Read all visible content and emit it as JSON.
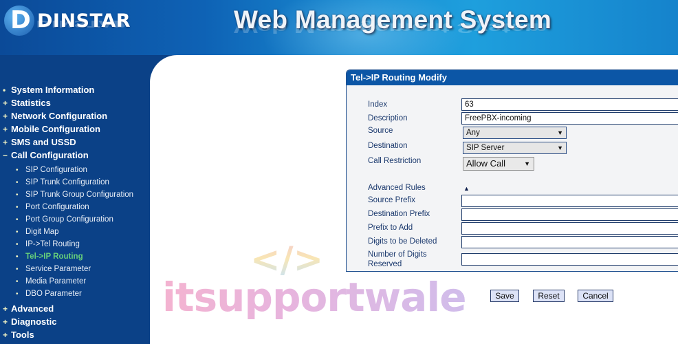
{
  "header": {
    "brand": "DINSTAR",
    "brand_mark": "D",
    "title": "Web Management System"
  },
  "sidebar": {
    "items": [
      {
        "symbol": "•",
        "label": "System Information"
      },
      {
        "symbol": "+",
        "label": "Statistics"
      },
      {
        "symbol": "+",
        "label": "Network Configuration"
      },
      {
        "symbol": "+",
        "label": "Mobile Configuration"
      },
      {
        "symbol": "+",
        "label": "SMS and USSD"
      },
      {
        "symbol": "−",
        "label": "Call Configuration"
      }
    ],
    "call_config_children": [
      {
        "label": "SIP Configuration"
      },
      {
        "label": "SIP Trunk Configuration"
      },
      {
        "label": "SIP Trunk Group Configuration"
      },
      {
        "label": "Port Configuration"
      },
      {
        "label": "Port Group Configuration"
      },
      {
        "label": "Digit Map"
      },
      {
        "label": "IP->Tel Routing"
      },
      {
        "label": "Tel->IP Routing",
        "active": true
      },
      {
        "label": "Service Parameter"
      },
      {
        "label": "Media Parameter"
      },
      {
        "label": "DBO Parameter"
      }
    ],
    "bottom_items": [
      {
        "symbol": "+",
        "label": "Advanced"
      },
      {
        "symbol": "+",
        "label": "Diagnostic"
      },
      {
        "symbol": "+",
        "label": "Tools"
      }
    ],
    "bullet": "•"
  },
  "form": {
    "title": "Tel->IP Routing Modify",
    "index": {
      "label": "Index",
      "value": "63"
    },
    "description": {
      "label": "Description",
      "value": "FreePBX-incoming"
    },
    "source": {
      "label": "Source",
      "value": "Any"
    },
    "destination": {
      "label": "Destination",
      "value": "SIP Server"
    },
    "call_restriction": {
      "label": "Call Restriction",
      "value": "Allow Call"
    },
    "advanced_rules": {
      "label": "Advanced Rules",
      "toggle": "▲"
    },
    "source_prefix": {
      "label": "Source Prefix",
      "value": ""
    },
    "destination_prefix": {
      "label": "Destination Prefix",
      "value": ""
    },
    "prefix_to_add": {
      "label": "Prefix to Add",
      "value": ""
    },
    "digits_deleted": {
      "label": "Digits to be Deleted",
      "value": ""
    },
    "digits_reserved": {
      "label_line1": "Number of Digits",
      "label_line2": "Reserved",
      "value": ""
    },
    "dropdown_arrow": "▼"
  },
  "buttons": {
    "save": "Save",
    "reset": "Reset",
    "cancel": "Cancel"
  },
  "watermark": {
    "code": "</>",
    "text": "itsupportwale"
  },
  "colors": {
    "sidebar_bg": "#0b4187",
    "panel_title_bg": "#0c56a6",
    "active_nav": "#67d07a",
    "button_bg": "#dde3f7"
  }
}
